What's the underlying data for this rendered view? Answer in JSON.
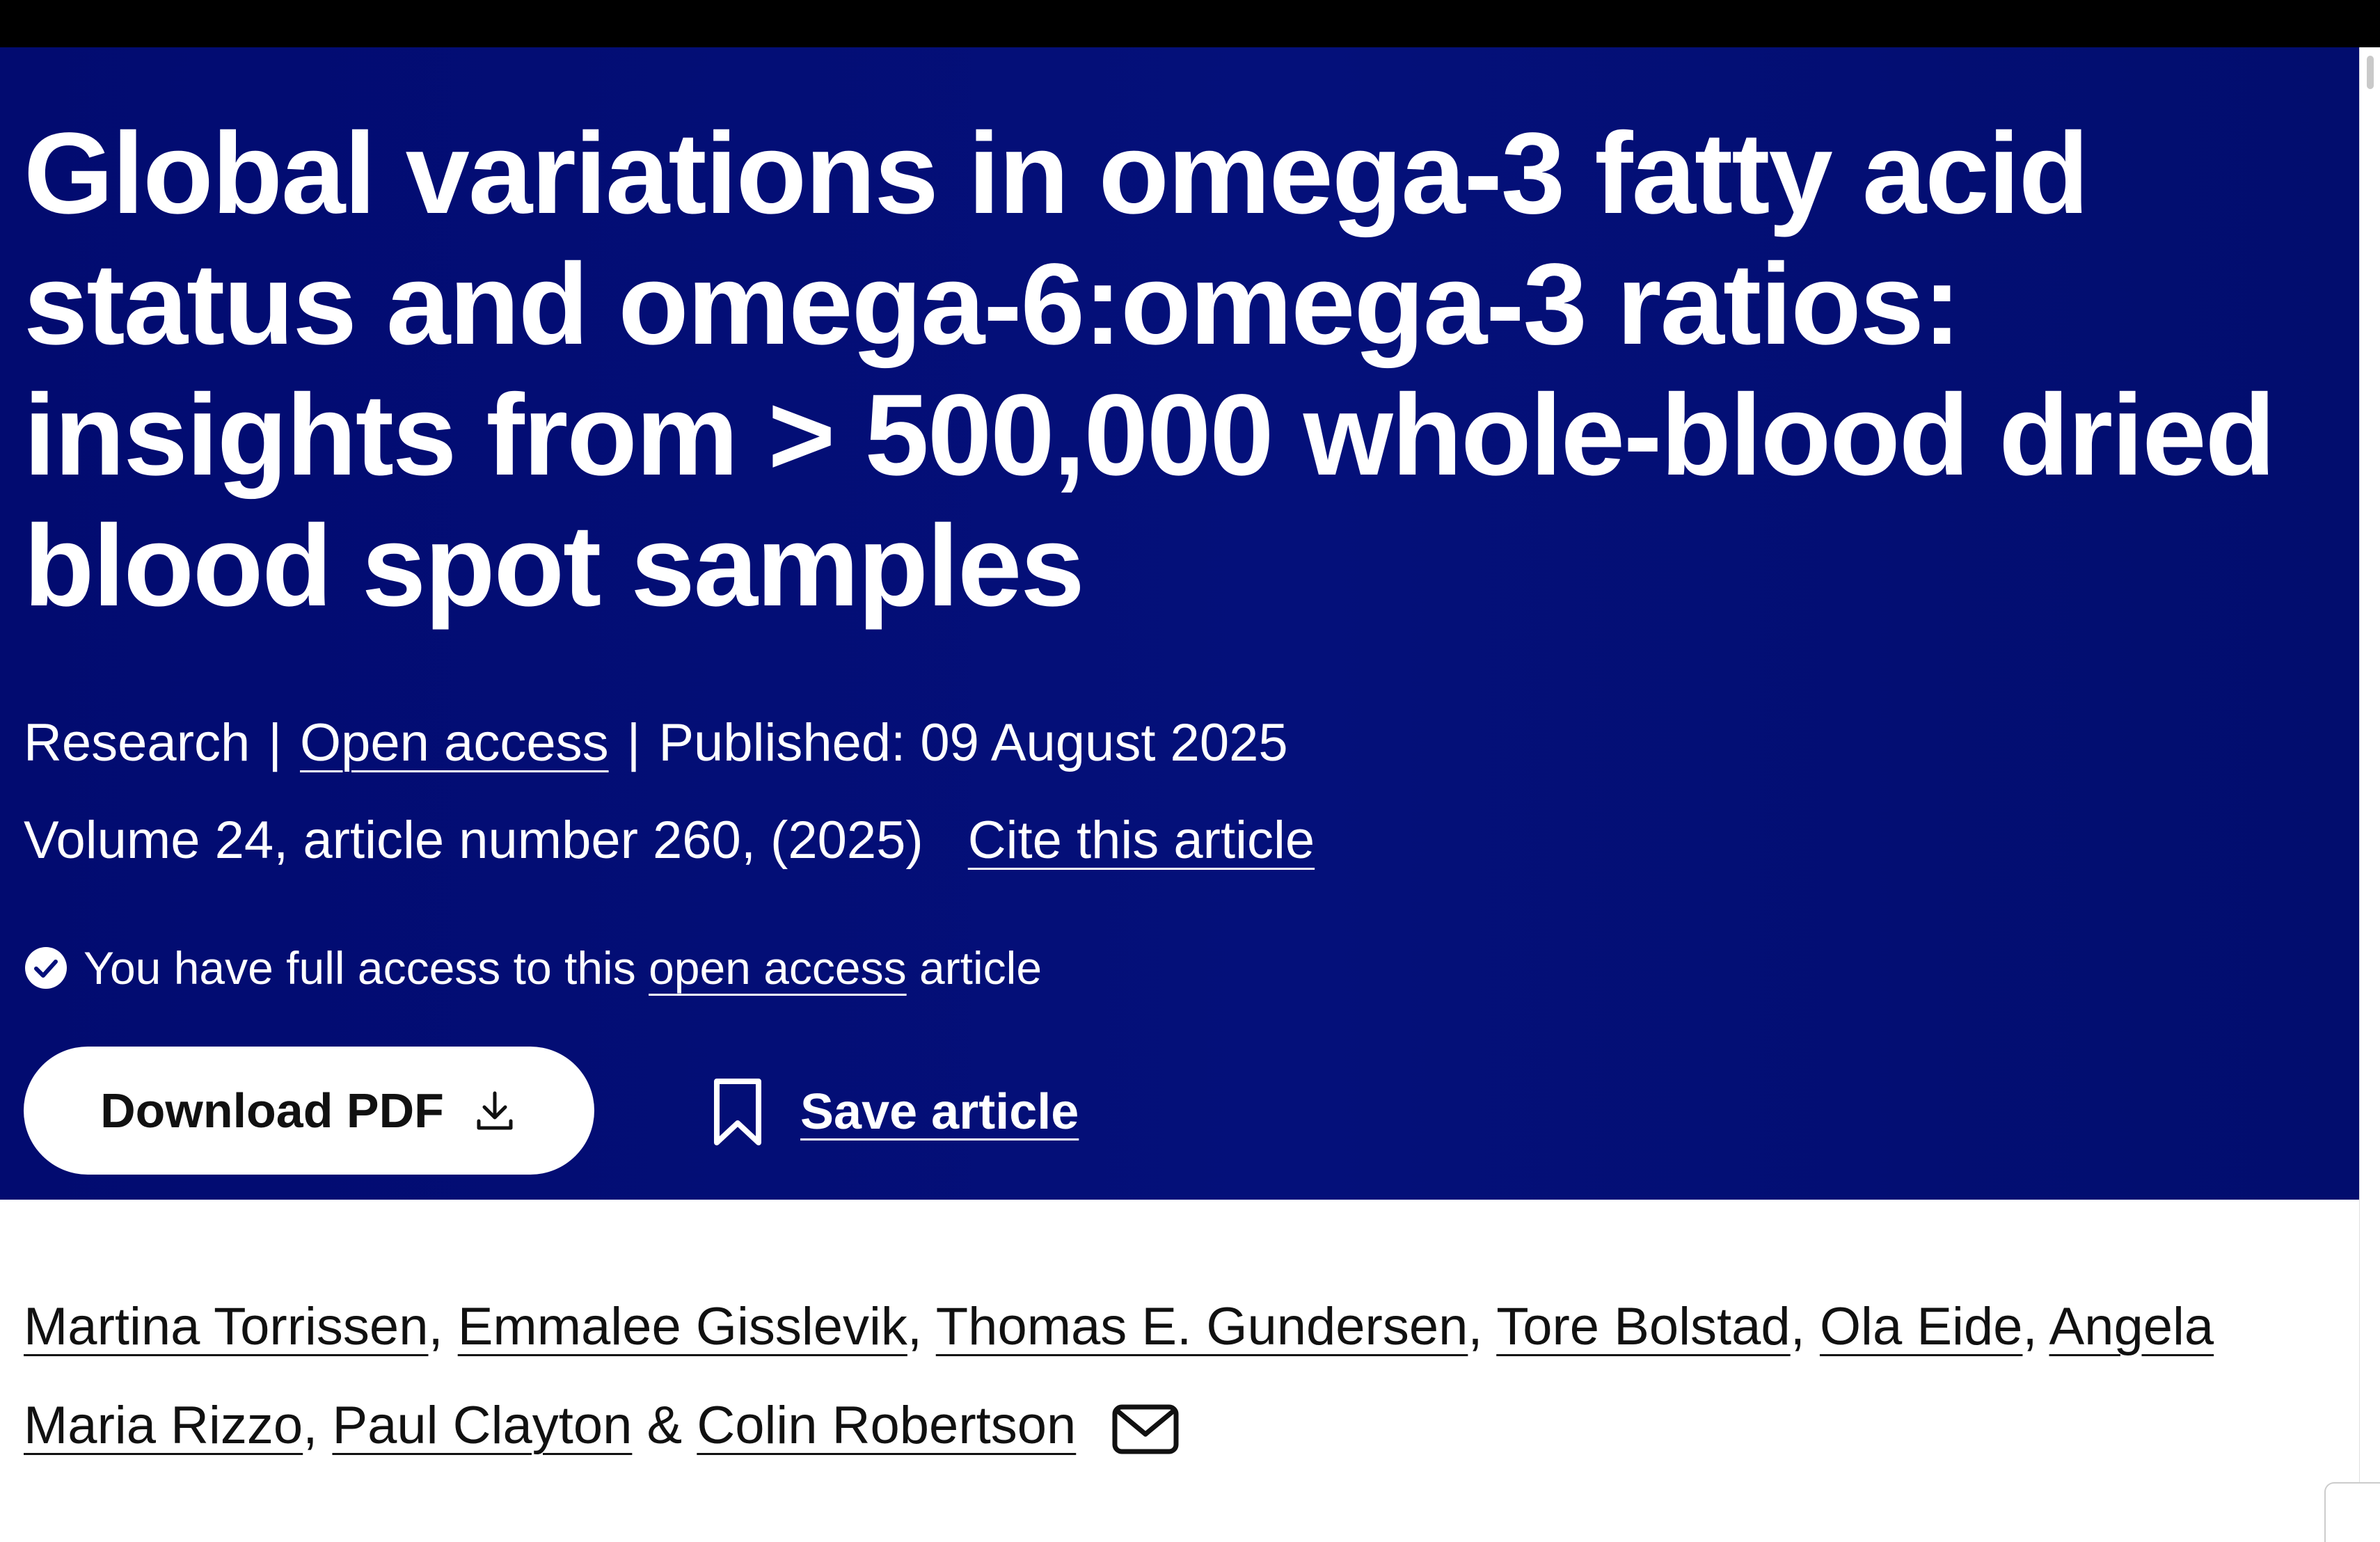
{
  "article": {
    "title": "Global variations in omega-3 fatty acid status and omega-6:omega-3 ratios: insights from > 500,000 whole-blood dried blood spot samples",
    "type": "Research",
    "separator": "|",
    "open_access_label": "Open access",
    "published": "Published: 09 August 2025",
    "volume_info": "Volume 24, article number 260, (2025)",
    "cite_label": "Cite this article",
    "access_prefix": "You have full access to this",
    "access_link": "open access",
    "access_suffix": "article",
    "download_pdf_label": "Download PDF",
    "save_article_label": "Save article"
  },
  "authors": {
    "names": [
      "Martina Torrissen",
      "Emmalee Gisslevik",
      "Thomas E. Gundersen",
      "Tore Bolstad",
      "Ola Eide",
      "Angela Maria Rizzo",
      "Paul Clayton",
      "Colin Robertson"
    ],
    "comma": ",",
    "ampersand": "&"
  },
  "icons": {
    "check": "check-circle-icon",
    "download": "download-icon",
    "bookmark": "bookmark-icon",
    "mail": "mail-icon"
  },
  "colors": {
    "hero_background": "#04107a",
    "top_bar": "#000000",
    "text_on_hero": "#ffffff",
    "body_text": "#111111"
  }
}
